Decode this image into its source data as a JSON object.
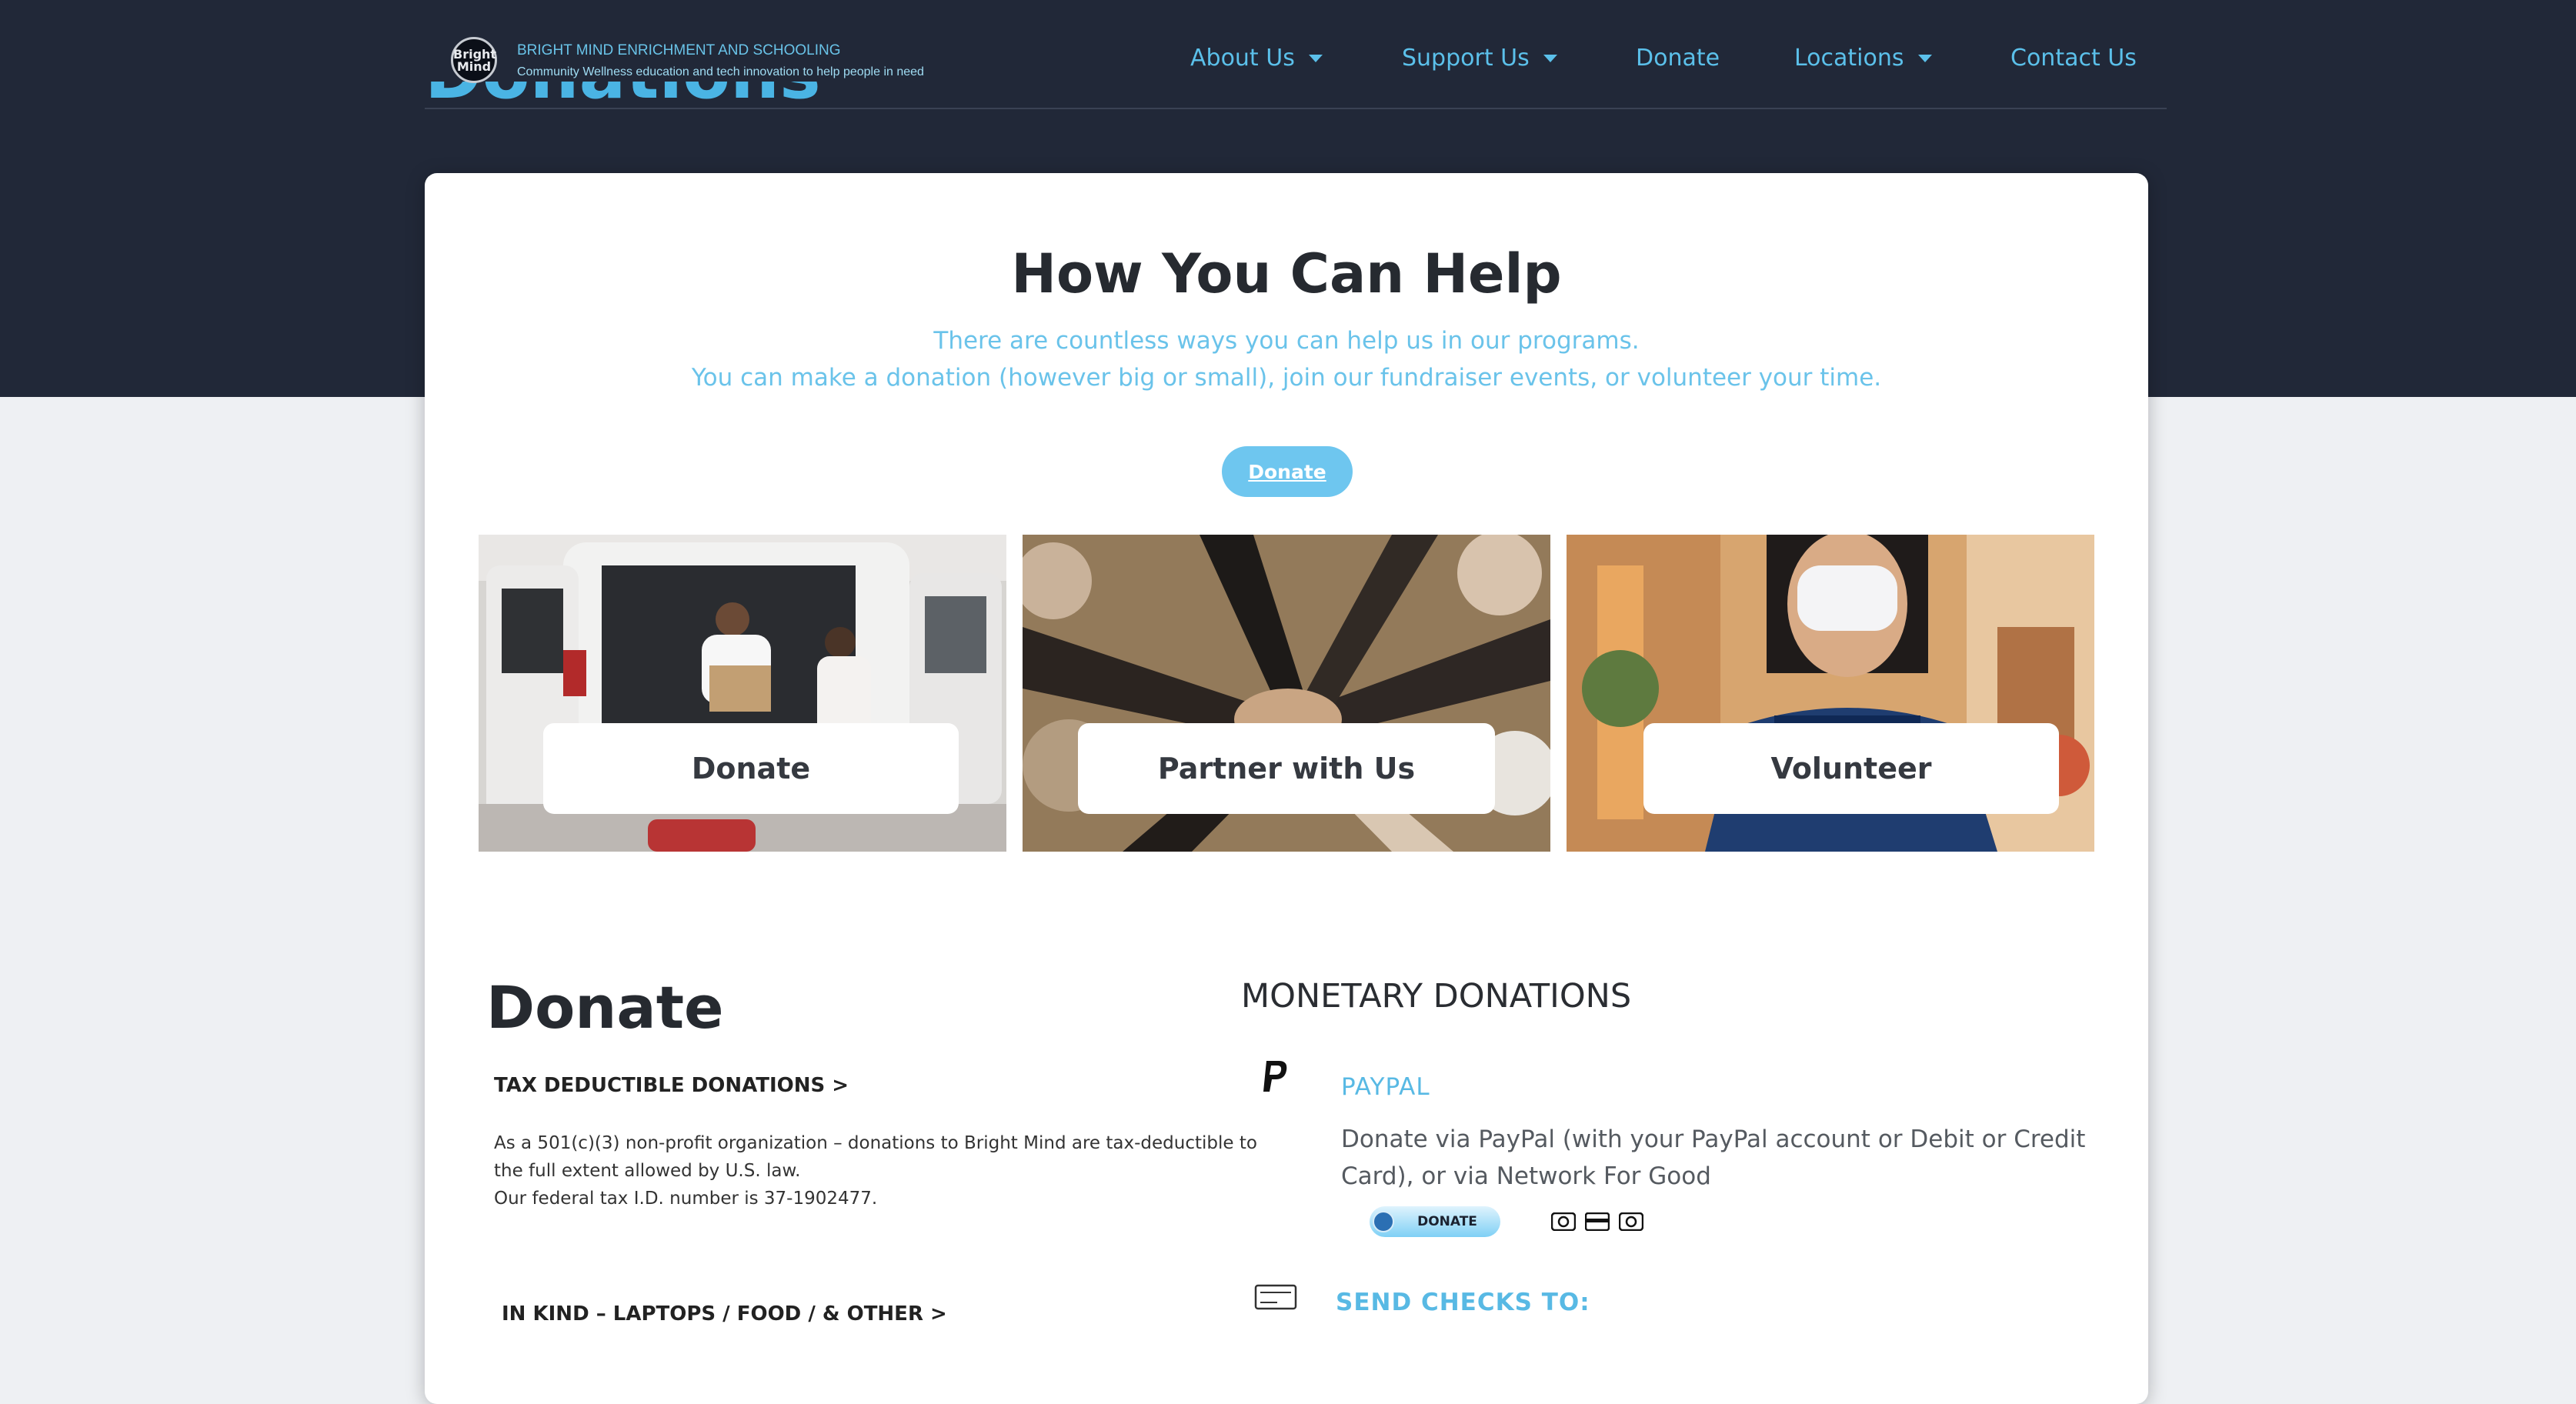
{
  "header": {
    "logo_line1": "Bright",
    "logo_line2": "Mind",
    "brand_name": "BRIGHT MIND ENRICHMENT AND SCHOOLING",
    "tagline": "Community Wellness education and tech innovation to help people in need",
    "nav": [
      {
        "label": "About Us",
        "dropdown": true
      },
      {
        "label": "Support Us",
        "dropdown": true
      },
      {
        "label": "Donate",
        "dropdown": false
      },
      {
        "label": "Locations",
        "dropdown": true
      },
      {
        "label": "Contact Us",
        "dropdown": false
      }
    ]
  },
  "hero": {
    "page_title": "Donations"
  },
  "help": {
    "title": "How You Can Help",
    "line1": "There are countless ways you can help us in our programs.",
    "line2": "You can make a donation (however big or small), join our fundraiser events, or volunteer your time.",
    "button": "Donate"
  },
  "tiles": [
    {
      "label": "Donate"
    },
    {
      "label": "Partner with Us"
    },
    {
      "label": "Volunteer"
    }
  ],
  "donate_section": {
    "title": "Donate",
    "tax_heading": "TAX DEDUCTIBLE DONATIONS >",
    "tax_text_1": "As a 501(c)(3) non-profit organization – donations to Bright Mind are tax-deductible to the full extent allowed by U.S. law.",
    "tax_text_2": "Our federal tax I.D. number is 37-1902477.",
    "inkind_heading": "IN KIND – LAPTOPS / FOOD / & OTHER >"
  },
  "monetary": {
    "title": "MONETARY DONATIONS",
    "paypal_title": "PAYPAL",
    "paypal_text": "Donate via PayPal (with your PayPal account or Debit or Credit Card), or via Network For Good",
    "paypal_button": "DONATE",
    "checks_title": "SEND CHECKS TO:"
  },
  "colors": {
    "hero_bg": "#212838",
    "accent": "#5bc0ea",
    "page_bg": "#eef0f3"
  }
}
